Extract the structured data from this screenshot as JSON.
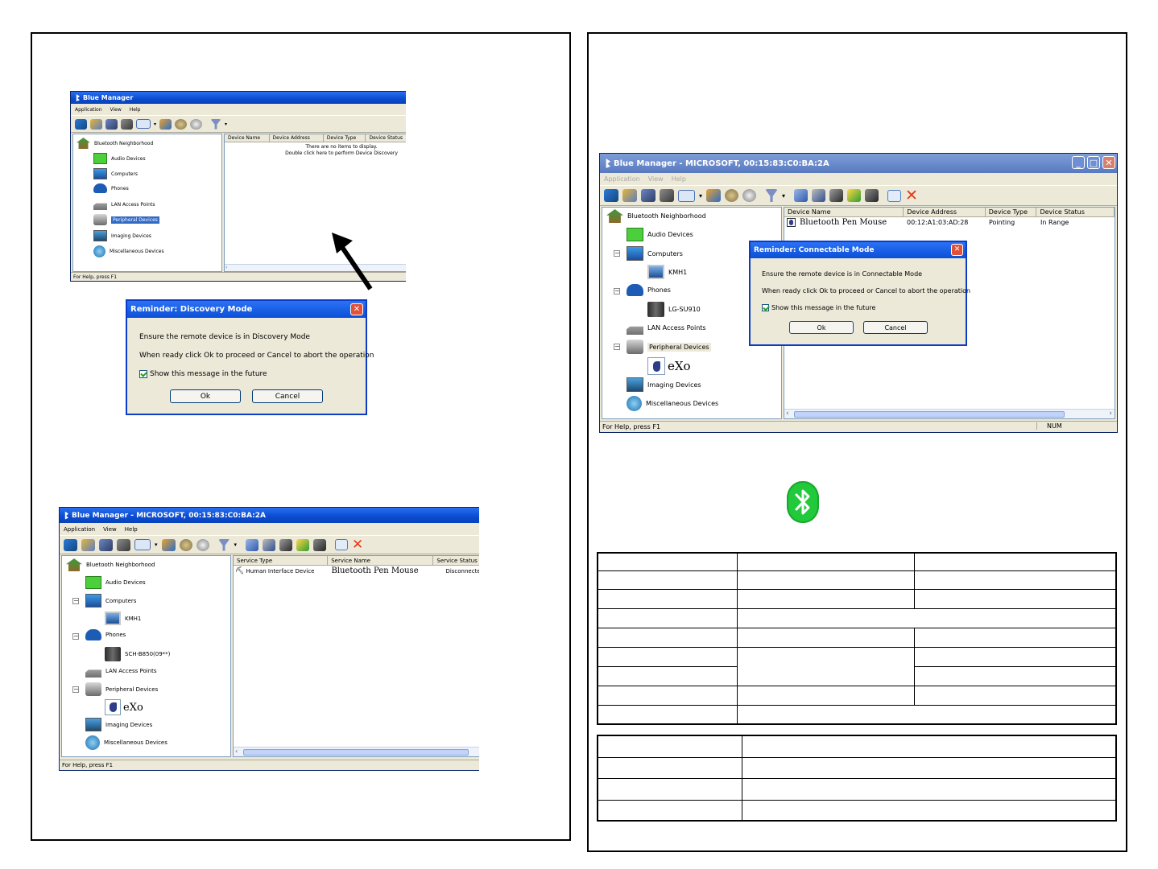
{
  "app": {
    "title": "Blue Manager",
    "title_full": "Blue Manager - MICROSOFT, 00:15:83:C0:BA:2A",
    "menu": [
      "Application",
      "View",
      "Help"
    ],
    "status": "For Help, press F1",
    "status_num": "NUM"
  },
  "tree": {
    "root": "Bluetooth Neighborhood",
    "audio": "Audio Devices",
    "computers": "Computers",
    "computer_kmh": "KMH1",
    "phones": "Phones",
    "phone_sch": "SCH-B850(09**)",
    "phone_lg": "LG-SU910",
    "lan": "LAN Access Points",
    "peripheral": "Peripheral Devices",
    "exo": "eXo",
    "imaging": "Imaging Devices",
    "misc": "Miscellaneous Devices"
  },
  "device_list": {
    "headers": [
      "Device Name",
      "Device Address",
      "Device Type",
      "Device Status"
    ],
    "empty_line1": "There are no items to display.",
    "empty_line2": "Double click here to perform Device Discovery",
    "row": {
      "name": "Bluetooth Pen Mouse",
      "address": "00:12:A1:03:AD:28",
      "type": "Pointing",
      "status": "In Range"
    }
  },
  "service_list": {
    "headers": [
      "Service Type",
      "Service Name",
      "Service Status"
    ],
    "row": {
      "type": "Human Interface Device",
      "name": "Bluetooth Pen Mouse",
      "status": "Disconnected"
    }
  },
  "dialog_discovery": {
    "title": "Reminder:  Discovery Mode",
    "line1": "Ensure the remote device is in   Discovery Mode",
    "line2": "When ready click Ok to proceed or Cancel to abort the operation",
    "checkbox": "Show this message in the future",
    "ok": "Ok",
    "cancel": "Cancel"
  },
  "dialog_connectable": {
    "title": "Reminder:  Connectable Mode",
    "line1": "Ensure the remote device is in    Connectable Mode",
    "line2": "When ready click Ok to proceed or Cancel to abort the operation",
    "checkbox": "Show this message in the future",
    "ok": "Ok",
    "cancel": "Cancel"
  },
  "colors": {
    "xp_blue": "#0a4bd0",
    "bt_green": "#22c93b",
    "selection": "#316ac5"
  },
  "icons": [
    "pointer-arrow-icon",
    "bluetooth-icon",
    "close-icon",
    "minimize-icon",
    "maximize-icon"
  ]
}
